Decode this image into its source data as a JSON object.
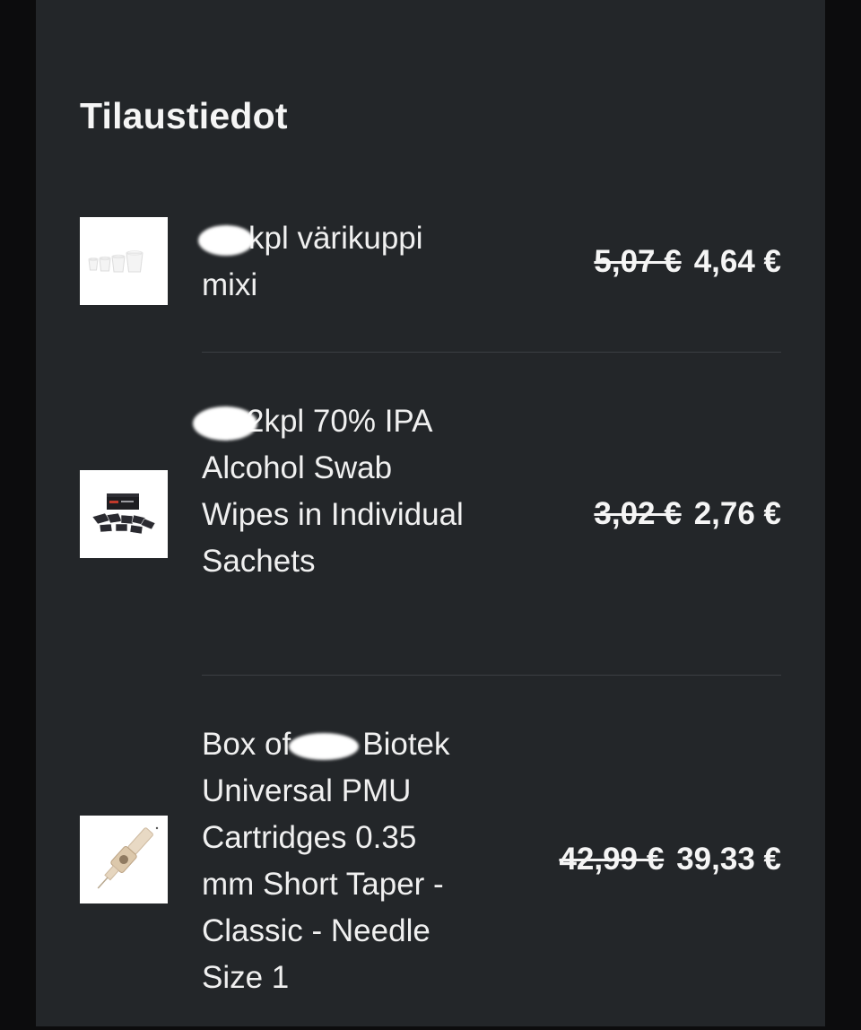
{
  "order": {
    "title": "Tilaustiedot",
    "items": [
      {
        "name": "kpl värikuppi mixi",
        "old_price": "5,07 €",
        "price": "4,64 €",
        "thumb_icon": "ink-cups-icon"
      },
      {
        "name": "2kpl 70% IPA Alcohol Swab Wipes in Individual Sachets",
        "old_price": "3,02 €",
        "price": "2,76 €",
        "thumb_icon": "alcohol-swab-box-icon"
      },
      {
        "name_prefix": "Box of",
        "name": "Biotek Universal PMU Cartridges 0.35 mm Short Taper - Classic - Needle Size 1",
        "old_price": "42,99 €",
        "price": "39,33 €",
        "thumb_icon": "pmu-cartridge-icon"
      }
    ]
  },
  "colors": {
    "background": "#232629",
    "text": "#f2f2f2",
    "divider": "#3b3f43"
  }
}
